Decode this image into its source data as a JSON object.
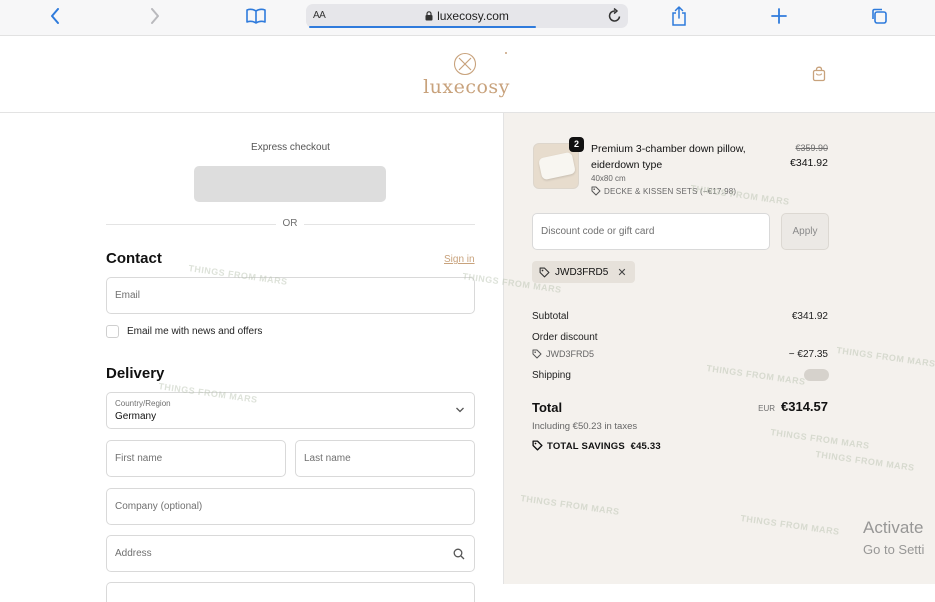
{
  "browser": {
    "url": "luxecosy.com",
    "text_size_label": "AA",
    "icons": [
      "back-icon",
      "forward-icon",
      "bookmarks-icon",
      "lock-icon",
      "reload-icon",
      "share-icon",
      "new-tab-icon",
      "tabs-icon"
    ]
  },
  "site": {
    "logo_text": "luxecosy",
    "brand_color": "#c8a27c"
  },
  "checkout": {
    "express_title": "Express checkout",
    "or_label": "OR",
    "contact": {
      "title": "Contact",
      "sign_in_label": "Sign in",
      "email_placeholder": "Email",
      "newsletter_label": "Email me with news and offers",
      "newsletter_checked": false
    },
    "delivery": {
      "title": "Delivery",
      "country_label": "Country/Region",
      "country_value": "Germany",
      "first_name_placeholder": "First name",
      "last_name_placeholder": "Last name",
      "company_placeholder": "Company (optional)",
      "address_placeholder": "Address"
    }
  },
  "summary": {
    "item": {
      "quantity": "2",
      "name": "Premium 3-chamber down pillow, eiderdown type",
      "variant": "40x80 cm",
      "discount_text": "DECKE & KISSEN SETS (−€17.98)",
      "price_original": "€359.90",
      "price_current": "€341.92"
    },
    "discount_placeholder": "Discount code or gift card",
    "apply_label": "Apply",
    "applied_code": "JWD3FRD5",
    "subtotal_label": "Subtotal",
    "subtotal_value": "€341.92",
    "order_discount_label": "Order discount",
    "order_discount_code": "JWD3FRD5",
    "order_discount_value": "− €27.35",
    "shipping_label": "Shipping",
    "total_label": "Total",
    "total_currency": "EUR",
    "total_value": "€314.57",
    "taxes_text": "Including €50.23 in taxes",
    "savings_text": "TOTAL SAVINGS  €45.33",
    "background_color": "#f4f1ed"
  },
  "watermark_text": "THINGS FROM MARS",
  "windows_overlay": {
    "title": "Activate",
    "subtitle": "Go to Setti"
  }
}
